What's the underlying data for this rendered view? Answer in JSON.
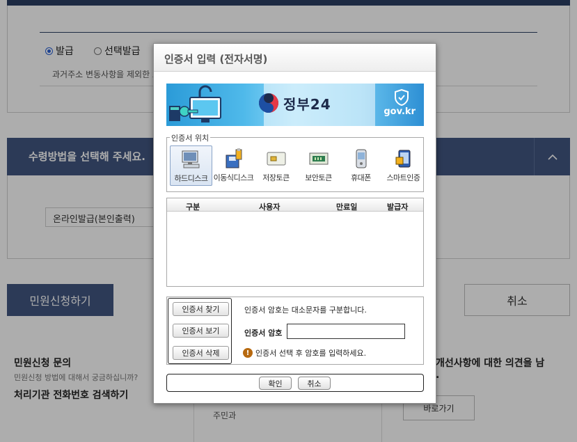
{
  "background": {
    "issue_options": [
      {
        "label": "발급",
        "selected": true
      },
      {
        "label": "선택발급",
        "selected": false
      }
    ],
    "issue_note": "과거주소 변동사항을 제외한 모",
    "receive_panel_title": "수령방법을 선택해 주세요.",
    "receive_select_value": "온라인발급(본인출력)",
    "apply_button": "민원신청하기",
    "cancel_button": "취소",
    "inquiry_title": "민원신청 문의",
    "inquiry_sub": "민원신청 방법에 대해서 궁금하십니까?",
    "inquiry_link": "처리기관 전화번호 검색하기",
    "middle_text": "주민과",
    "feedback_title": "개선사항에 대한 의견을 남",
    "feedback_title_cont": ".",
    "feedback_button": "바로가기"
  },
  "dialog": {
    "title": "인증서 입력 (전자서명)",
    "banner": {
      "brand": "정부24",
      "domain": "gov.kr"
    },
    "location_legend": "인증서 위치",
    "locations": [
      {
        "label": "하드디스크",
        "icon": "hard-disk-icon",
        "selected": true
      },
      {
        "label": "이동식디스크",
        "icon": "removable-disk-icon",
        "selected": false
      },
      {
        "label": "저장토큰",
        "icon": "storage-token-icon",
        "selected": false
      },
      {
        "label": "보안토큰",
        "icon": "security-token-icon",
        "selected": false
      },
      {
        "label": "휴대폰",
        "icon": "mobile-phone-icon",
        "selected": false
      },
      {
        "label": "스마트인증",
        "icon": "smart-auth-icon",
        "selected": false
      }
    ],
    "table_headers": [
      "구분",
      "사용자",
      "만료일",
      "발급자"
    ],
    "buttons": {
      "find": "인증서 찾기",
      "view": "인증서 보기",
      "delete": "인증서 삭제",
      "ok": "확인",
      "cancel": "취소"
    },
    "password_info": "인증서 암호는 대소문자를 구분합니다.",
    "password_label": "인증서 암호",
    "password_value": "",
    "warning_text": "인증서 선택 후 암호를 입력하세요.",
    "colors": {
      "accent": "#425680",
      "banner": "#4fb9ea",
      "warning": "#b7690f"
    }
  }
}
